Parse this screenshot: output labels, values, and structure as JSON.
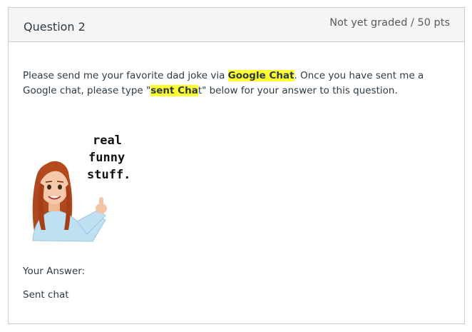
{
  "question": {
    "title": "Question 2",
    "points": "Not yet graded / 50 pts"
  },
  "prompt": {
    "text_1": "Please send me your favorite dad joke via ",
    "highlight_1": "Google Chat",
    "text_2": ".  Once you have sent me a Google chat, please type \"",
    "highlight_2": "sent Cha",
    "text_2b": "t",
    "text_3": "\" below for your answer to this question."
  },
  "sticker": {
    "icon": "avatar-thumbs-up-sticker",
    "caption_lines": [
      "real",
      "funny",
      "stuff."
    ]
  },
  "answer": {
    "label": "Your Answer:",
    "value": "Sent chat"
  },
  "colors": {
    "highlight": "#ffff33",
    "header_bg": "#f5f5f5",
    "border": "#c7cdd1"
  }
}
